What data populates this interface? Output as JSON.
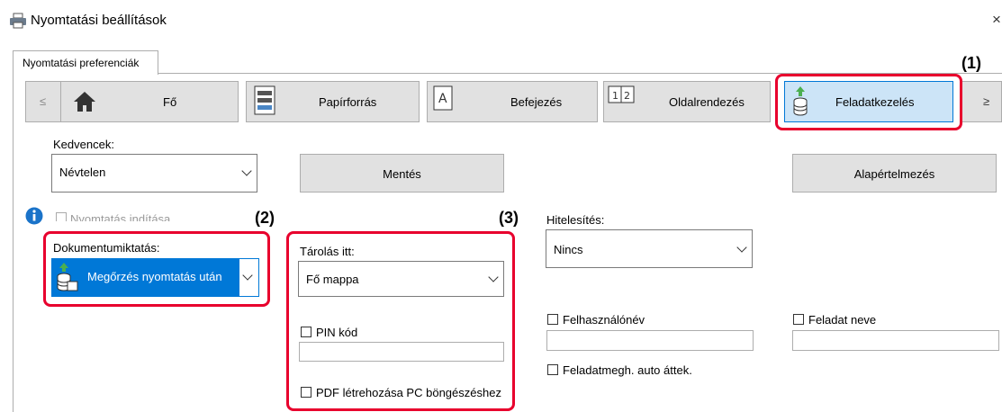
{
  "window": {
    "title": "Nyomtatási beállítások",
    "close_glyph": "×"
  },
  "tab": {
    "label": "Nyomtatási preferenciák"
  },
  "nav": {
    "prev": "≤",
    "next": "≥",
    "items": [
      {
        "label": "Fő",
        "icon": "home-icon"
      },
      {
        "label": "Papírforrás",
        "icon": "paper-tray-icon"
      },
      {
        "label": "Befejezés",
        "icon": "finishing-icon"
      },
      {
        "label": "Oldalrendezés",
        "icon": "page-layout-icon"
      },
      {
        "label": "Feladatkezelés",
        "icon": "job-handling-icon",
        "selected": true
      }
    ]
  },
  "favorites": {
    "label": "Kedvencek:",
    "value": "Névtelen",
    "save_label": "Mentés",
    "defaults_label": "Alapértelmezés"
  },
  "print_start": {
    "label": "Nyomtatás indítása",
    "checked": false
  },
  "doc_retention": {
    "label": "Dokumentumiktatás:",
    "value": "Megőrzés nyomtatás után"
  },
  "store_in": {
    "label": "Tárolás itt:",
    "value": "Fő mappa",
    "pin_label": "PIN kód",
    "pin_value": "",
    "pdf_label": "PDF létrehozása PC böngészéshez"
  },
  "authentication": {
    "label": "Hitelesítés:",
    "value": "Nincs"
  },
  "user_name": {
    "label": "Felhasználónév",
    "value": ""
  },
  "job_name": {
    "label": "Feladat neve",
    "value": ""
  },
  "auto_job_review": {
    "label": "Feladatmegh. auto áttek."
  },
  "callouts": {
    "c1": "(1)",
    "c2": "(2)",
    "c3": "(3)"
  },
  "colors": {
    "selected_tab_bg": "#cce4f7",
    "selected_tab_border": "#0078d7",
    "callout_red": "#e8002d",
    "retention_bg": "#0078d7"
  }
}
